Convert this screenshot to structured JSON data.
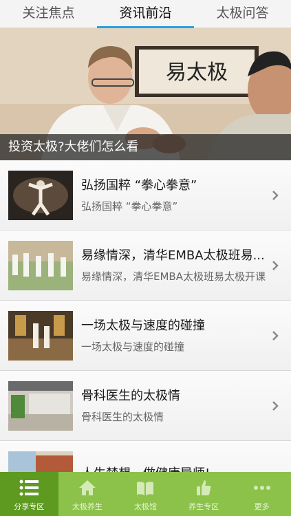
{
  "tabs": [
    {
      "label": "关注焦点",
      "active": false
    },
    {
      "label": "资讯前沿",
      "active": true
    },
    {
      "label": "太极问答",
      "active": false
    }
  ],
  "banner": {
    "caption": "投资太极?大佬们怎么看",
    "calligraphy": "易太极"
  },
  "articles": [
    {
      "title": "弘扬国粹 “拳心拳意”",
      "summary": "弘扬国粹 “拳心拳意”"
    },
    {
      "title": "易缘情深，清华EMBA太极班易...",
      "summary": "易缘情深，清华EMBA太极班易太极开课"
    },
    {
      "title": "一场太极与速度的碰撞",
      "summary": "一场太极与速度的碰撞"
    },
    {
      "title": "骨科医生的太极情",
      "summary": "骨科医生的太极情"
    },
    {
      "title": "人生梦想，做健康导师!",
      "summary": ""
    }
  ],
  "bottom_nav": [
    {
      "label": "分享专区",
      "icon": "list-icon",
      "active": true
    },
    {
      "label": "太极养生",
      "icon": "home-icon",
      "active": false
    },
    {
      "label": "太极馆",
      "icon": "book-icon",
      "active": false
    },
    {
      "label": "养生专区",
      "icon": "thumbs-up-icon",
      "active": false
    },
    {
      "label": "更多",
      "icon": "more-dots-icon",
      "active": false
    }
  ],
  "colors": {
    "accent": "#29a0e0",
    "nav_bg": "#8cc24a",
    "nav_active": "#5d9a1f"
  }
}
